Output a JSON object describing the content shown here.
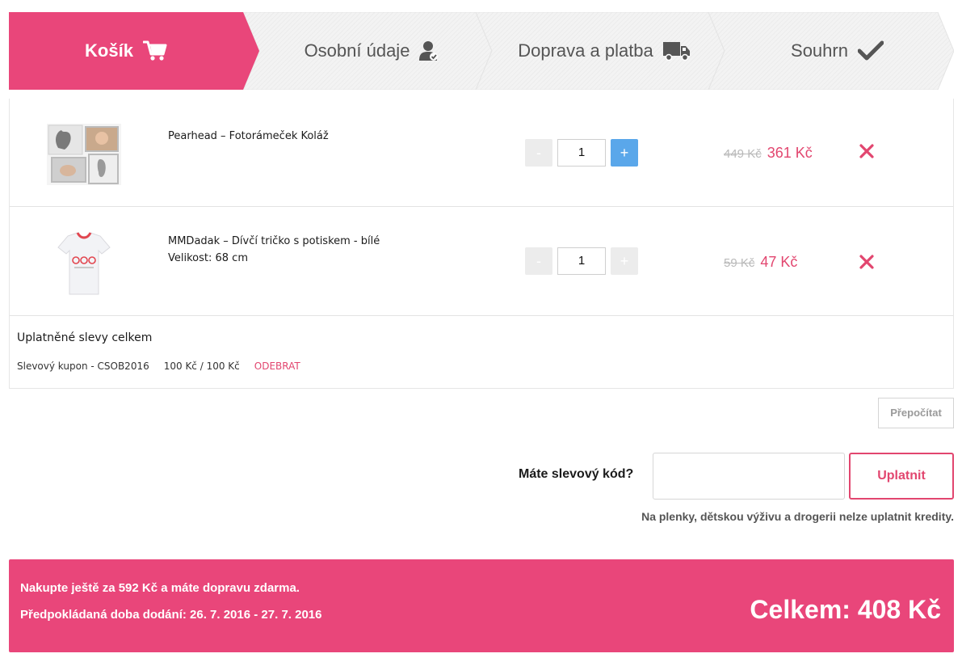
{
  "steps": [
    {
      "label": "Košík",
      "icon": "cart-icon",
      "active": true
    },
    {
      "label": "Osobní údaje",
      "icon": "user-icon",
      "active": false
    },
    {
      "label": "Doprava a platba",
      "icon": "truck-icon",
      "active": false
    },
    {
      "label": "Souhrn",
      "icon": "check-icon",
      "active": false
    }
  ],
  "cart": {
    "items": [
      {
        "name": "Pearhead – Fotorámeček Koláž",
        "variant": "",
        "quantity": "1",
        "minus_label": "-",
        "plus_label": "+",
        "old_price": "449 Kč",
        "price": "361 Kč"
      },
      {
        "name": "MMDadak – Dívčí tričko s potiskem - bílé",
        "variant": "Velikost: 68 cm",
        "quantity": "1",
        "minus_label": "-",
        "plus_label": "+",
        "old_price": "59 Kč",
        "price": "47 Kč"
      }
    ],
    "discounts": {
      "title": "Uplatněné slevy celkem",
      "coupon_name": "Slevový kupon - CSOB2016",
      "coupon_value": "100 Kč / 100 Kč",
      "remove_label": "ODEBRAT"
    }
  },
  "recalculate_label": "Přepočítat",
  "coupon": {
    "label": "Máte slevový kód?",
    "input_value": "",
    "apply_label": "Uplatnit",
    "note": "Na plenky, dětskou výživu a drogerii nelze uplatnit kredity."
  },
  "footer": {
    "free_shipping": "Nakupte ještě za 592 Kč a máte dopravu zdarma.",
    "delivery": "Předpokládaná doba dodání: 26. 7. 2016 - 27. 7. 2016",
    "total": "Celkem: 408 Kč"
  },
  "colors": {
    "accent": "#e9467a",
    "price": "#e2466f",
    "plus_active": "#5aa7ea"
  }
}
